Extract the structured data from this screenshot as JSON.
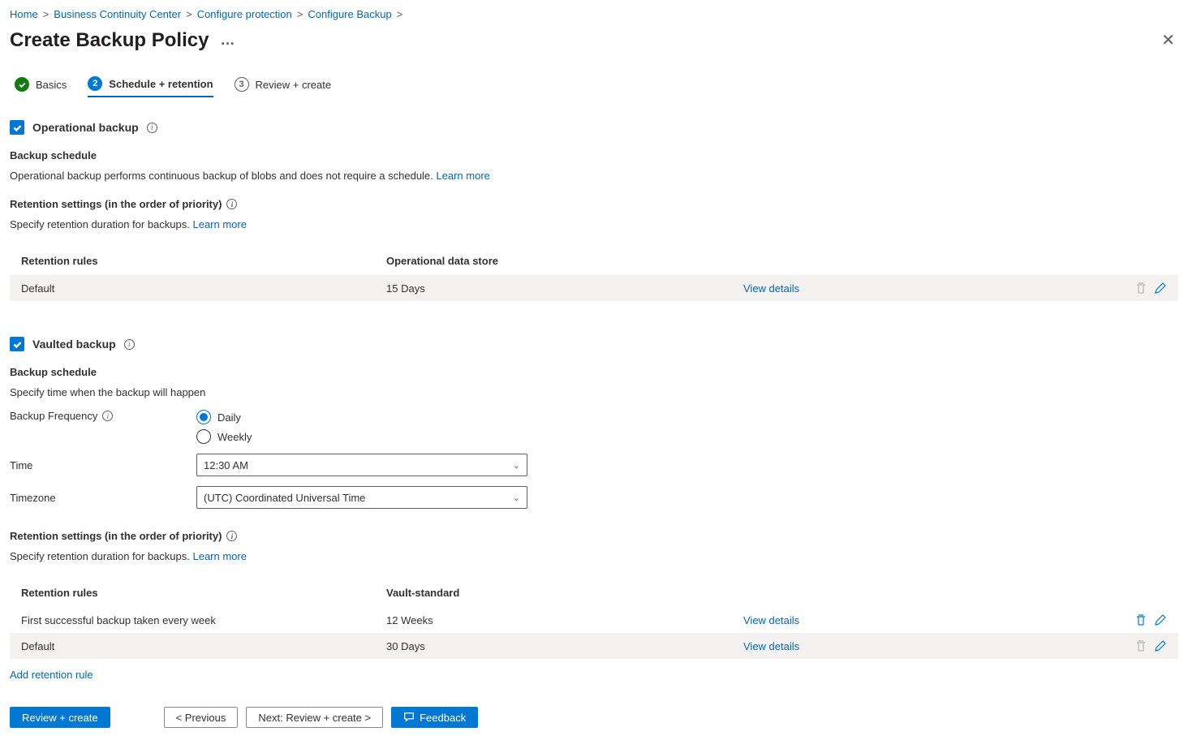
{
  "breadcrumb": {
    "items": [
      "Home",
      "Business Continuity Center",
      "Configure protection",
      "Configure Backup"
    ],
    "sep": ">"
  },
  "pageTitle": "Create Backup Policy",
  "tabs": [
    {
      "label": "Basics",
      "state": "done"
    },
    {
      "label": "Schedule + retention",
      "state": "current"
    },
    {
      "label": "Review + create",
      "state": "pending",
      "num": "3"
    }
  ],
  "operational": {
    "checkboxLabel": "Operational backup",
    "scheduleHeading": "Backup schedule",
    "scheduleText": "Operational backup performs continuous backup of blobs and does not require a schedule.",
    "scheduleLearnMore": "Learn more",
    "retentionHeading": "Retention settings (in the order of priority)",
    "retentionText": "Specify retention duration for backups.",
    "retentionLearnMore": "Learn more",
    "table": {
      "h1": "Retention rules",
      "h2": "Operational data store",
      "rows": [
        {
          "rule": "Default",
          "store": "15 Days",
          "view": "View details",
          "shaded": true,
          "deletable": false
        }
      ]
    }
  },
  "vaulted": {
    "checkboxLabel": "Vaulted backup",
    "scheduleHeading": "Backup schedule",
    "scheduleSub": "Specify time when the backup will happen",
    "freqLabel": "Backup Frequency",
    "freqOptions": {
      "daily": "Daily",
      "weekly": "Weekly"
    },
    "freqSelected": "daily",
    "timeLabel": "Time",
    "timeValue": "12:30 AM",
    "tzLabel": "Timezone",
    "tzValue": "(UTC) Coordinated Universal Time",
    "retentionHeading": "Retention settings (in the order of priority)",
    "retentionText": "Specify retention duration for backups.",
    "retentionLearnMore": "Learn more",
    "table": {
      "h1": "Retention rules",
      "h2": "Vault-standard",
      "rows": [
        {
          "rule": "First successful backup taken every week",
          "store": "12 Weeks",
          "view": "View details",
          "shaded": false,
          "deletable": true
        },
        {
          "rule": "Default",
          "store": "30 Days",
          "view": "View details",
          "shaded": true,
          "deletable": false
        }
      ]
    },
    "addRule": "Add retention rule"
  },
  "footer": {
    "reviewCreate": "Review + create",
    "previous": "< Previous",
    "next": "Next: Review + create >",
    "feedback": "Feedback"
  }
}
